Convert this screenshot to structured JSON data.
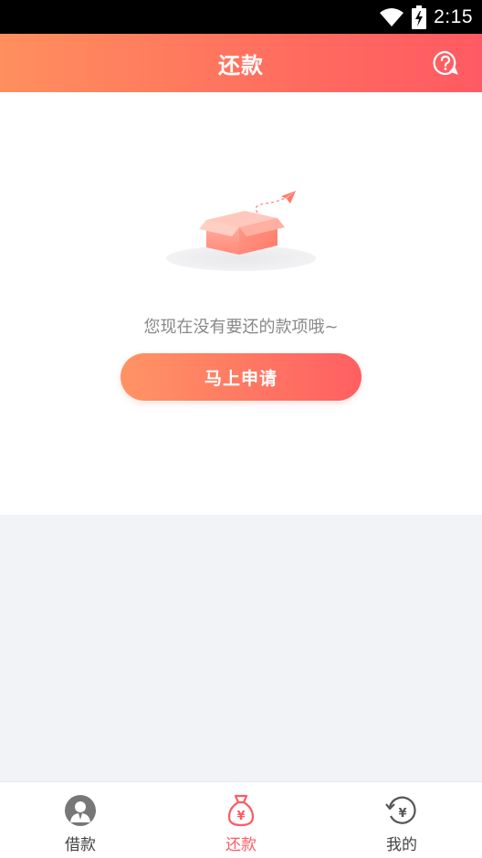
{
  "status_bar": {
    "time": "2:15",
    "icons": [
      "wifi-icon",
      "battery-charging-icon"
    ]
  },
  "header": {
    "title": "还款",
    "help_icon": "help-circle-icon"
  },
  "content": {
    "empty_text": "您现在没有要还的款项哦~",
    "apply_button_label": "马上申请",
    "illustration": "empty-box-illustration"
  },
  "nav": {
    "items": [
      {
        "label": "借款",
        "icon": "user-avatar-icon",
        "active": false
      },
      {
        "label": "还款",
        "icon": "money-bag-icon",
        "active": true
      },
      {
        "label": "我的",
        "icon": "yuan-refresh-icon",
        "active": false
      }
    ]
  },
  "colors": {
    "accent": "#ff5a63",
    "gradient_start": "#ff8f5e",
    "gradient_end": "#ff5a63",
    "page_background": "#f2f3f7",
    "muted_text": "#888888"
  }
}
